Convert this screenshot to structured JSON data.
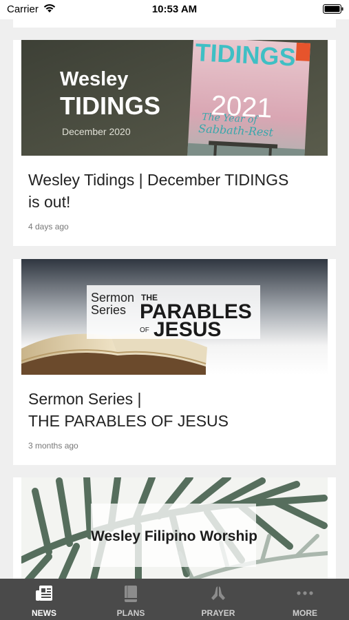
{
  "status_bar": {
    "carrier": "Carrier",
    "time": "10:53 AM"
  },
  "posts": [
    {
      "title": "Wesley Tidings | December TIDINGS\nis out!",
      "time": "4 days ago",
      "image": {
        "line1": "Wesley",
        "line2": "TIDINGS",
        "line3": "December 2020",
        "mag_title": "TIDINGS",
        "mag_year": "2021",
        "mag_theme1": "The Year of",
        "mag_theme2": "Sabbath-Rest"
      }
    },
    {
      "title": "Sermon Series |\nTHE PARABLES OF JESUS",
      "time": "3 months ago",
      "image": {
        "series_line1": "Sermon",
        "series_line2": "Series",
        "the": "THE",
        "parables": "PARABLES",
        "of": "OF",
        "jesus": "JESUS"
      }
    },
    {
      "image": {
        "caption": "Wesley Filipino Worship"
      }
    }
  ],
  "tabs": [
    {
      "label": "NEWS",
      "icon": "news-icon",
      "active": true
    },
    {
      "label": "PLANS",
      "icon": "book-icon",
      "active": false
    },
    {
      "label": "PRAYER",
      "icon": "praying-hands-icon",
      "active": false
    },
    {
      "label": "MORE",
      "icon": "more-dots-icon",
      "active": false
    }
  ],
  "colors": {
    "tabbar": "#4a4a4a",
    "background": "#efefef",
    "card": "#ffffff"
  }
}
